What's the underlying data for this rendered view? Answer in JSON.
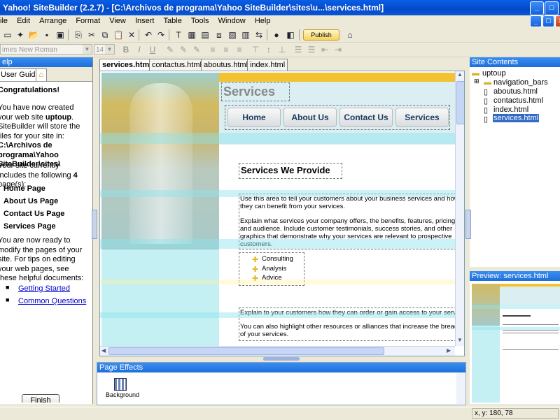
{
  "window": {
    "title": "Yahoo! SiteBuilder (2.2.7) - [C:\\Archivos de programa\\Yahoo SiteBuilder\\sites\\u...\\services.html]"
  },
  "menu": [
    "ile",
    "Edit",
    "Arrange",
    "Format",
    "View",
    "Insert",
    "Table",
    "Tools",
    "Window",
    "Help"
  ],
  "toolbar": {
    "publish_label": "Publish",
    "font_name": "imes New Roman",
    "font_size": "14"
  },
  "left_panel": {
    "header": "elp",
    "tab_user_guide": "User Guide",
    "congrats": "Congratulations!",
    "intro_1": "You have now created your web site ",
    "site_name": "uptoup",
    "intro_2": ". SiteBuilder will store the files for your site in: ",
    "path": "C:\\Archivos de programa\\Yahoo SiteBuilder\\sites\\",
    "includes_1": "Your site currently includes the following ",
    "page_count": "4",
    "includes_2": " page(s):",
    "pages": [
      "Home Page",
      "About Us Page",
      "Contact Us Page",
      "Services Page"
    ],
    "ready_text": "You are now ready to modify the pages of your site. For tips on editing your web pages, see these helpful documents:",
    "links": [
      "Getting Started",
      "Common Questions"
    ],
    "finish_label": "Finish"
  },
  "doc_tabs": [
    "services.html",
    "contactus.html",
    "aboutus.html",
    "index.html"
  ],
  "page": {
    "title": "Services",
    "nav": [
      "Home",
      "About Us",
      "Contact Us",
      "Services"
    ],
    "heading": "Services We Provide",
    "para1": "Use this area to tell your customers about your business services and how they can benefit from your services.",
    "para2": "Explain what services your company offers, the benefits, features, pricing and audience. Include customer testimonials, success stories, and other graphics that demonstrate why your services are relevant to prospective customers.",
    "list": [
      "Consulting",
      "Analysis",
      "Advice"
    ],
    "para3": "Explain to your customers how they can order or gain access to your services.",
    "para4": "You can also highlight other resources or alliances that increase the breadth of your services."
  },
  "page_effects": {
    "header": "Page Effects",
    "item": "Background"
  },
  "site_contents": {
    "header": "Site Contents",
    "root": "uptoup",
    "folder": "navigation_bars",
    "files": [
      "aboutus.html",
      "contactus.html",
      "index.html",
      "services.html"
    ]
  },
  "preview": {
    "header": "Preview: services.html"
  },
  "status": {
    "coords": "x, y: 180, 78"
  }
}
